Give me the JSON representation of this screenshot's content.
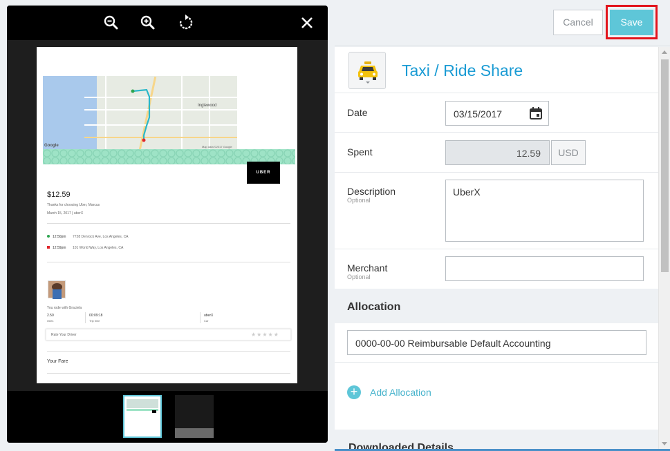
{
  "viewer": {
    "toolbar": {
      "zoom_out_icon": "zoom-out-icon",
      "zoom_in_icon": "zoom-in-icon",
      "rotate_icon": "rotate-icon",
      "close_icon": "close-icon"
    },
    "receipt": {
      "map_labels": [
        "Inglewood",
        "Map data ©2017 Google",
        "Google"
      ],
      "brand": "UBER",
      "amount": "$12.59",
      "thanks": "Thanks for choosing Uber, Marcus",
      "date_line": "March 15, 2017 | uberX",
      "pickup_time": "12:50pm",
      "pickup_address": "7728 Denrock Ave, Los Angeles, CA",
      "dropoff_time": "12:59pm",
      "dropoff_address": "101 World Way, Los Angeles, CA",
      "rode_with": "You rode with Graciela",
      "stats": [
        {
          "value": "2.50",
          "label": "miles"
        },
        {
          "value": "00:09:18",
          "label": "Trip time"
        },
        {
          "value": "uberX",
          "label": "Car"
        }
      ],
      "rate_driver": "Rate Your Driver",
      "stars": "★★★★★",
      "your_fare": "Your Fare"
    }
  },
  "header": {
    "cancel_label": "Cancel",
    "save_label": "Save"
  },
  "form": {
    "category_title": "Taxi / Ride Share",
    "category_icon": "taxi-icon",
    "date": {
      "label": "Date",
      "value": "03/15/2017"
    },
    "spent": {
      "label": "Spent",
      "value": "12.59",
      "currency": "USD"
    },
    "description": {
      "label": "Description",
      "sublabel": "Optional",
      "value": "UberX"
    },
    "merchant": {
      "label": "Merchant",
      "sublabel": "Optional",
      "value": ""
    },
    "allocation": {
      "title": "Allocation",
      "value": "0000-00-00 Reimbursable Default Accounting",
      "add_label": "Add Allocation"
    },
    "downloaded_details": {
      "title": "Downloaded Details"
    }
  },
  "colors": {
    "accent": "#5ec6d8",
    "title_blue": "#1a9bd4",
    "highlight_red": "#e2141c"
  }
}
